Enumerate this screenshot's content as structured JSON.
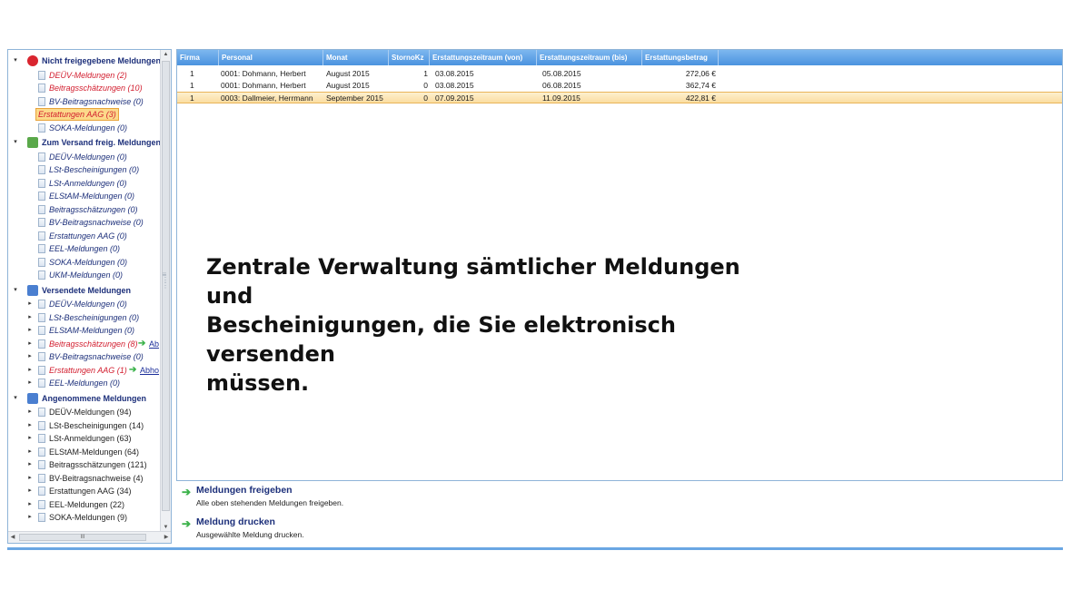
{
  "tree": {
    "groups": [
      {
        "label": "Nicht freigegebene Meldungen",
        "icon": "stop-icon",
        "items": [
          {
            "label": "DEÜV-Meldungen (2)",
            "style": "red"
          },
          {
            "label": "Beitragsschätzungen (10)",
            "style": "red"
          },
          {
            "label": "BV-Beitragsnachweise (0)",
            "style": "blue"
          },
          {
            "label": "Erstattungen AAG (3)",
            "style": "selected"
          },
          {
            "label": "SOKA-Meldungen (0)",
            "style": "blue"
          }
        ]
      },
      {
        "label": "Zum Versand freig. Meldungen",
        "icon": "mail-icon",
        "items": [
          {
            "label": "DEÜV-Meldungen (0)",
            "style": "blue"
          },
          {
            "label": "LSt-Bescheinigungen (0)",
            "style": "blue"
          },
          {
            "label": "LSt-Anmeldungen (0)",
            "style": "blue"
          },
          {
            "label": "ELStAM-Meldungen (0)",
            "style": "blue"
          },
          {
            "label": "Beitragsschätzungen (0)",
            "style": "blue"
          },
          {
            "label": "BV-Beitragsnachweise (0)",
            "style": "blue"
          },
          {
            "label": "Erstattungen AAG (0)",
            "style": "blue"
          },
          {
            "label": "EEL-Meldungen (0)",
            "style": "blue"
          },
          {
            "label": "SOKA-Meldungen (0)",
            "style": "blue"
          },
          {
            "label": "UKM-Meldungen (0)",
            "style": "blue"
          }
        ]
      },
      {
        "label": "Versendete Meldungen",
        "icon": "sent-icon",
        "items": [
          {
            "label": "DEÜV-Meldungen (0)",
            "style": "blue"
          },
          {
            "label": "LSt-Bescheinigungen (0)",
            "style": "blue"
          },
          {
            "label": "ELStAM-Meldungen (0)",
            "style": "blue"
          },
          {
            "label": "Beitragsschätzungen (8)",
            "style": "red",
            "link": "Ab"
          },
          {
            "label": "BV-Beitragsnachweise (0)",
            "style": "blue"
          },
          {
            "label": "Erstattungen AAG (1)",
            "style": "red",
            "link": "Abho"
          },
          {
            "label": "EEL-Meldungen (0)",
            "style": "blue"
          }
        ]
      },
      {
        "label": "Angenommene Meldungen",
        "icon": "accepted-icon",
        "items": [
          {
            "label": "DEÜV-Meldungen (94)",
            "style": "plain"
          },
          {
            "label": "LSt-Bescheinigungen (14)",
            "style": "plain"
          },
          {
            "label": "LSt-Anmeldungen (63)",
            "style": "plain"
          },
          {
            "label": "ELStAM-Meldungen (64)",
            "style": "plain"
          },
          {
            "label": "Beitragsschätzungen (121)",
            "style": "plain"
          },
          {
            "label": "BV-Beitragsnachweise (4)",
            "style": "plain"
          },
          {
            "label": "Erstattungen AAG (34)",
            "style": "plain"
          },
          {
            "label": "EEL-Meldungen (22)",
            "style": "plain"
          },
          {
            "label": "SOKA-Meldungen (9)",
            "style": "plain"
          }
        ]
      }
    ],
    "hscroll_grip": "III"
  },
  "grid": {
    "columns": [
      "Firma",
      "Personal",
      "Monat",
      "StornoKz",
      "Erstattungszeitraum (von)",
      "Erstattungszeitraum (bis)",
      "Erstattungsbetrag"
    ],
    "rows": [
      {
        "firma": "1",
        "personal": "0001: Dohmann, Herbert",
        "monat": "August 2015",
        "storno": "1",
        "von": "03.08.2015",
        "bis": "05.08.2015",
        "betrag": "272,06 €",
        "selected": false
      },
      {
        "firma": "1",
        "personal": "0001: Dohmann, Herbert",
        "monat": "August 2015",
        "storno": "0",
        "von": "03.08.2015",
        "bis": "06.08.2015",
        "betrag": "362,74 €",
        "selected": false
      },
      {
        "firma": "1",
        "personal": "0003: Dallmeier, Herrmann",
        "monat": "September 2015",
        "storno": "0",
        "von": "07.09.2015",
        "bis": "11.09.2015",
        "betrag": "422,81 €",
        "selected": true
      }
    ]
  },
  "caption": {
    "line1": "Zentrale Verwaltung sämtlicher Meldungen und",
    "line2": "Bescheinigungen, die Sie elektronisch versenden",
    "line3": "müssen."
  },
  "actions": [
    {
      "title": "Meldungen freigeben",
      "desc": "Alle oben stehenden Meldungen freigeben."
    },
    {
      "title": "Meldung drucken",
      "desc": "Ausgewählte Meldung drucken."
    }
  ],
  "colors": {
    "accent_blue": "#4a93df",
    "alert_red": "#d21d2e",
    "link_green": "#3bb24a",
    "selection": "#fbdda1"
  }
}
